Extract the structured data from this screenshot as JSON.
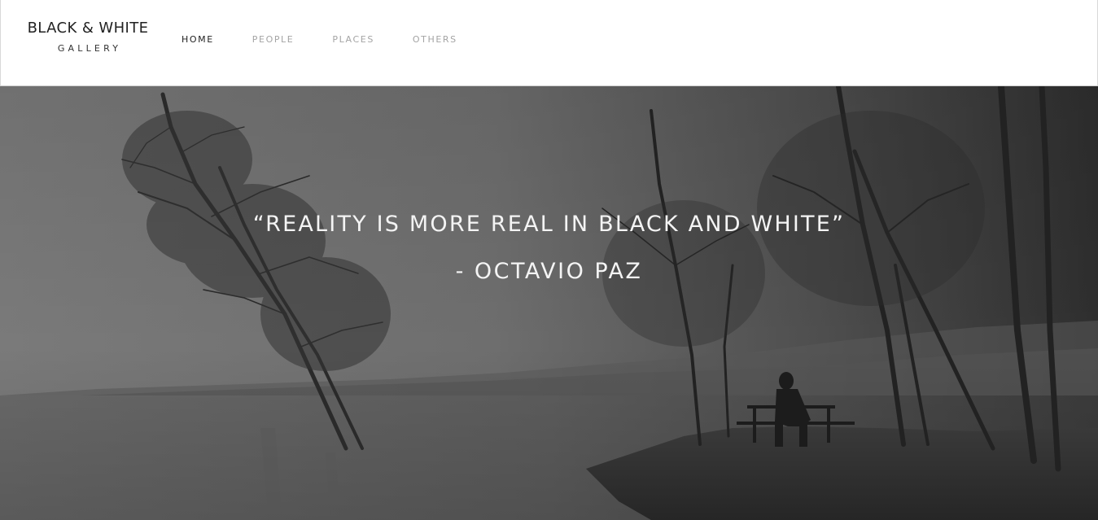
{
  "brand": {
    "title": "BLACK & WHITE",
    "subtitle": "GALLERY"
  },
  "nav": {
    "items": [
      {
        "label": "HOME",
        "active": true
      },
      {
        "label": "PEOPLE",
        "active": false
      },
      {
        "label": "PLACES",
        "active": false
      },
      {
        "label": "OTHERS",
        "active": false
      }
    ]
  },
  "hero": {
    "image": "foggy-lake-trees-photo",
    "quote": "“REALITY IS MORE REAL IN BLACK AND WHITE”",
    "author": "- OCTAVIO PAZ"
  },
  "colors": {
    "header_bg": "#ffffff",
    "nav_active": "#222222",
    "nav_inactive": "#a4a4a4",
    "hero_text": "#f4f4f4"
  }
}
